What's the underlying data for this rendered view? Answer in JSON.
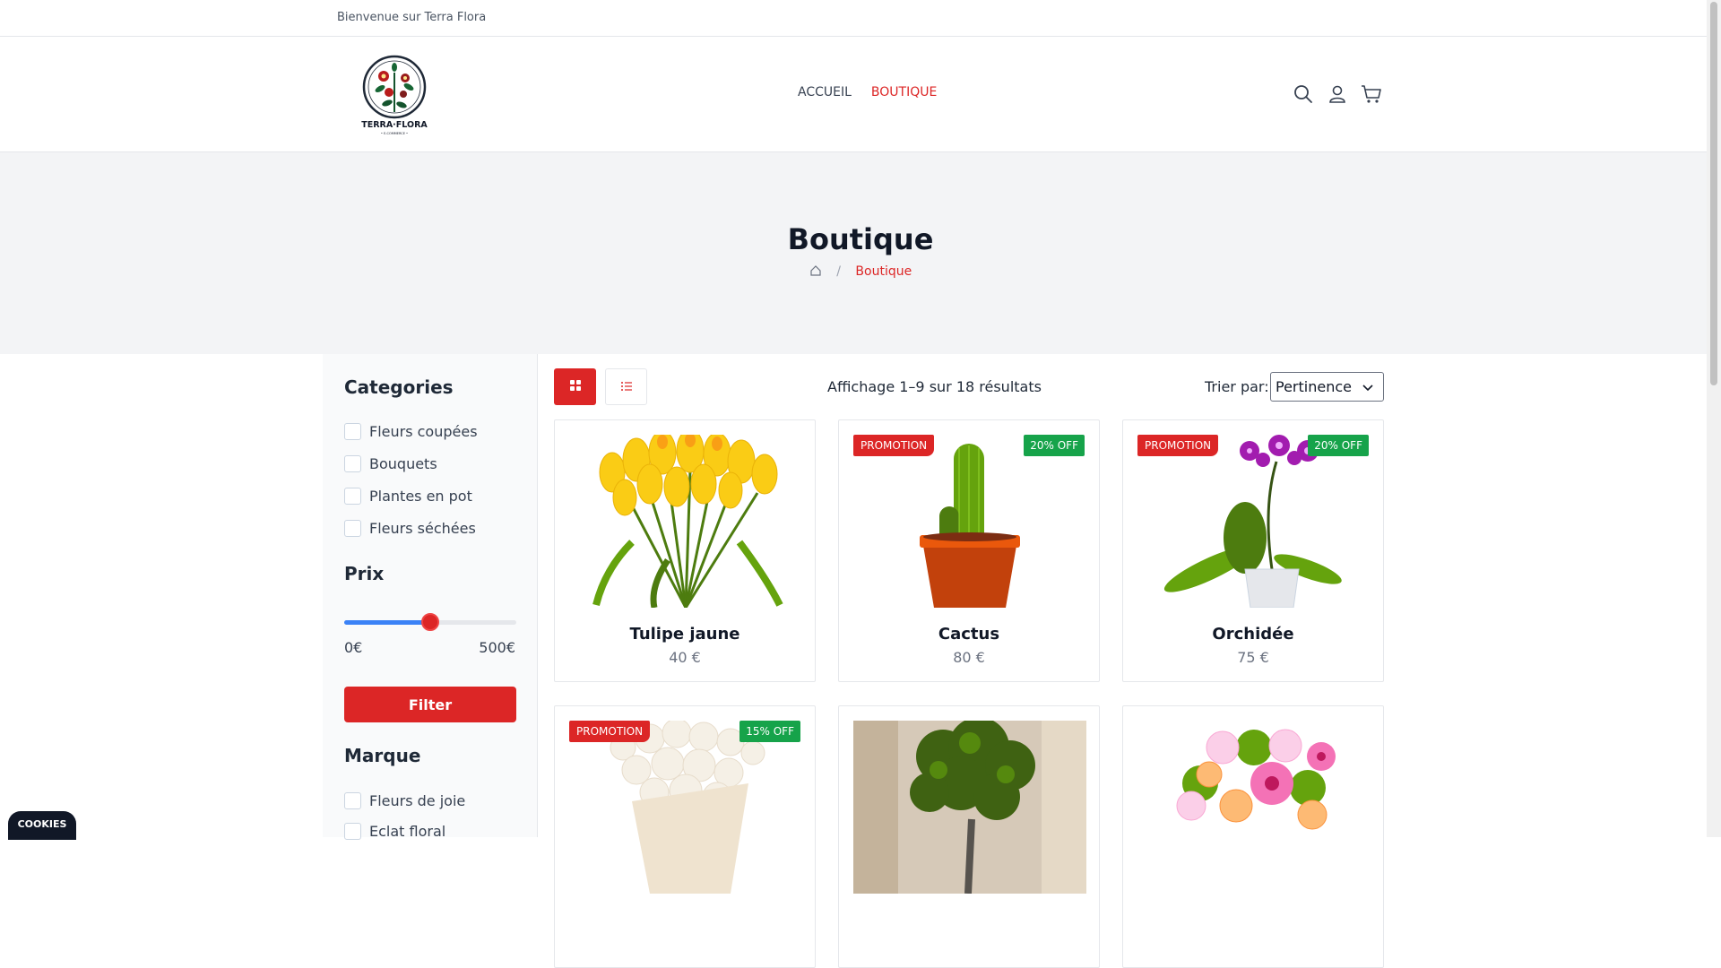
{
  "topbar": {
    "welcome": "Bienvenue sur Terra Flora"
  },
  "header": {
    "logo_text": "TERRA·FLORA",
    "logo_subtext": "E-COMMERCE",
    "nav": [
      {
        "label": "ACCUEIL",
        "active": false
      },
      {
        "label": "BOUTIQUE",
        "active": true
      }
    ],
    "icons": [
      "search-icon",
      "user-icon",
      "cart-icon"
    ]
  },
  "hero": {
    "title": "Boutique",
    "breadcrumb": {
      "home_icon": "home-icon",
      "separator": "/",
      "current": "Boutique"
    }
  },
  "sidebar": {
    "categories_title": "Categories",
    "categories": [
      "Fleurs coupées",
      "Bouquets",
      "Plantes en pot",
      "Fleurs séchées"
    ],
    "price_title": "Prix",
    "price_min": "0€",
    "price_max": "500€",
    "price_slider_value": 0.5,
    "filter_label": "Filter",
    "brand_title": "Marque",
    "brands": [
      "Fleurs de joie",
      "Eclat floral"
    ]
  },
  "toolbar": {
    "grid_view_icon": "grid-icon",
    "list_view_icon": "list-icon",
    "results": "Affichage 1–9 sur 18 résultats",
    "sort_label": "Trier par:",
    "sort_value": "Pertinence"
  },
  "products": [
    {
      "name": "Tulipe jaune",
      "price": "40 €",
      "promo": "",
      "discount": ""
    },
    {
      "name": "Cactus",
      "price": "80 €",
      "promo": "PROMOTION",
      "discount": "20% OFF"
    },
    {
      "name": "Orchidée",
      "price": "75 €",
      "promo": "PROMOTION",
      "discount": "20% OFF"
    },
    {
      "name": "",
      "price": "",
      "promo": "PROMOTION",
      "discount": "15% OFF"
    },
    {
      "name": "",
      "price": "",
      "promo": "",
      "discount": ""
    },
    {
      "name": "",
      "price": "",
      "promo": "",
      "discount": ""
    }
  ],
  "cookies": {
    "label": "COOKIES"
  },
  "colors": {
    "accent": "#dc2626",
    "discount": "#16a34a",
    "hero_bg": "#f3f4f6",
    "slider_fill": "#3b82f6"
  }
}
